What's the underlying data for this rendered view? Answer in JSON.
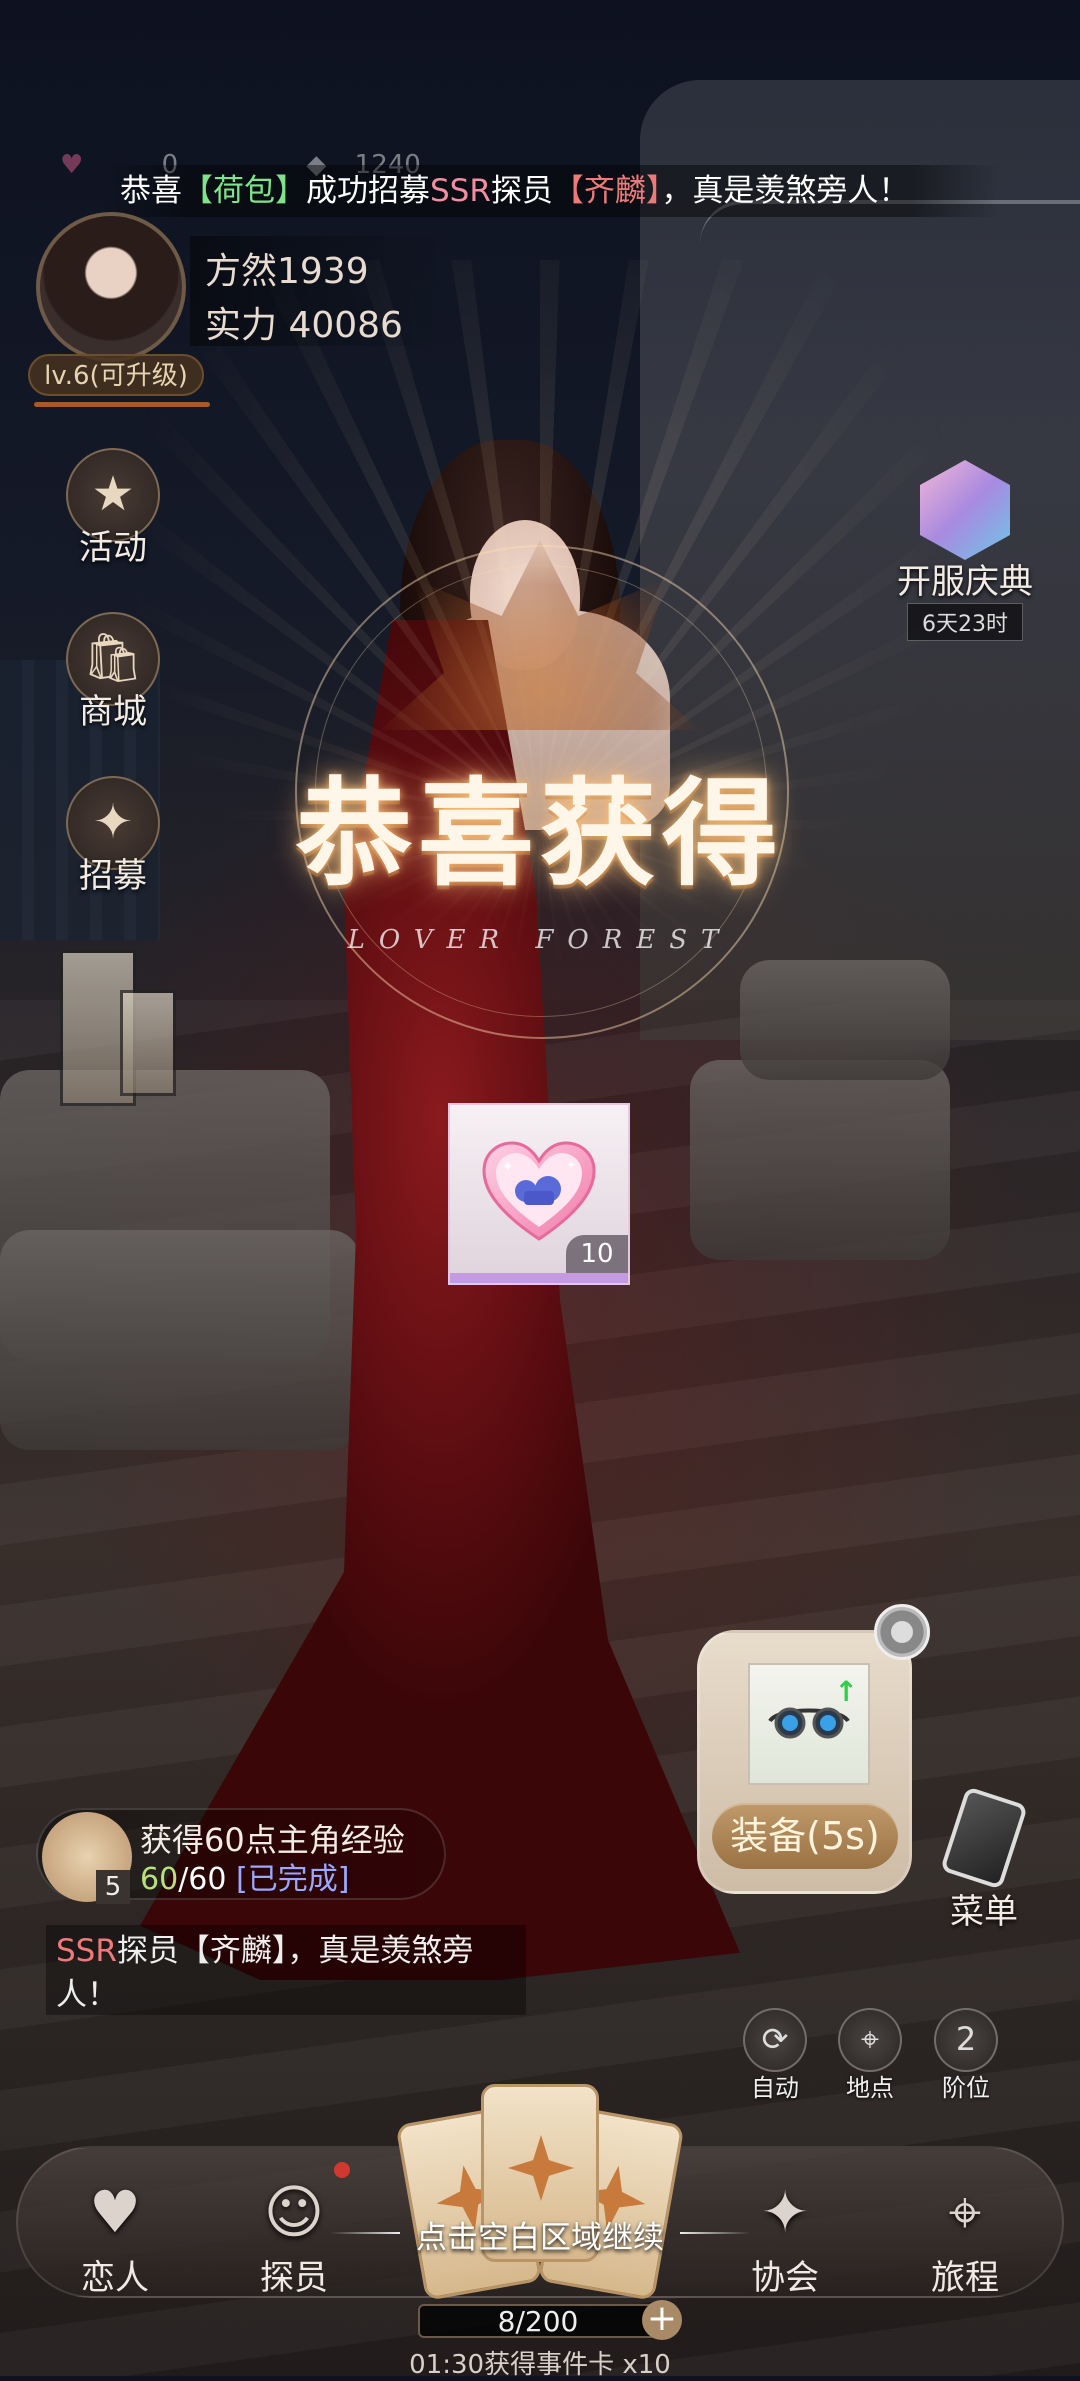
{
  "banner": {
    "text_prefix": "恭喜",
    "player": "【荷包】",
    "middle": "成功招募",
    "rarity": "SSR",
    "role": "探员",
    "hero": "【齐麟】",
    "suffix": "，真是羡煞旁人！"
  },
  "resources": {
    "hearts": "0",
    "coins": "1240"
  },
  "player": {
    "name": "方然1939",
    "power": "实力 40086",
    "level": "lv.6(可升级)"
  },
  "side_menu": [
    {
      "label": "活动",
      "icon": "star-icon"
    },
    {
      "label": "商城",
      "icon": "shopping-bag-icon"
    },
    {
      "label": "招募",
      "icon": "recruit-card-icon"
    }
  ],
  "event": {
    "label": "开服庆典",
    "timer": "6天23时",
    "icon": "gem-icon"
  },
  "reward_popup": {
    "title": "恭喜获得",
    "subtitle": "LOVER FOREST",
    "item_icon": "heart-badge-icon",
    "quantity": "10"
  },
  "equip": {
    "button": "装备(5s)",
    "item_icon": "goggles-icon"
  },
  "task": {
    "title": "获得60点主角经验",
    "progress_num": "60",
    "progress_total": "/60",
    "status": "[已完成]",
    "badge": "5"
  },
  "chat": {
    "rarity": "SSR",
    "text1": "探员【齐麟】，真是羡煞旁",
    "text2": "人！"
  },
  "menu_label": "菜单",
  "quick_buttons": [
    {
      "label": "自动",
      "icon": "refresh-icon"
    },
    {
      "label": "地点",
      "icon": "map-pin-icon"
    },
    {
      "label": "阶位",
      "icon": "rank-icon",
      "value": "2"
    }
  ],
  "bottom_nav": [
    {
      "label": "恋人",
      "icon": "lover-icon"
    },
    {
      "label": "探员",
      "icon": "agent-icon"
    },
    {
      "label": "协会",
      "icon": "association-icon"
    },
    {
      "label": "旅程",
      "icon": "journey-icon"
    }
  ],
  "continue_hint": "点击空白区域继续",
  "event_cards": {
    "count": "8/200",
    "timer": "01:30获得事件卡 x10"
  }
}
